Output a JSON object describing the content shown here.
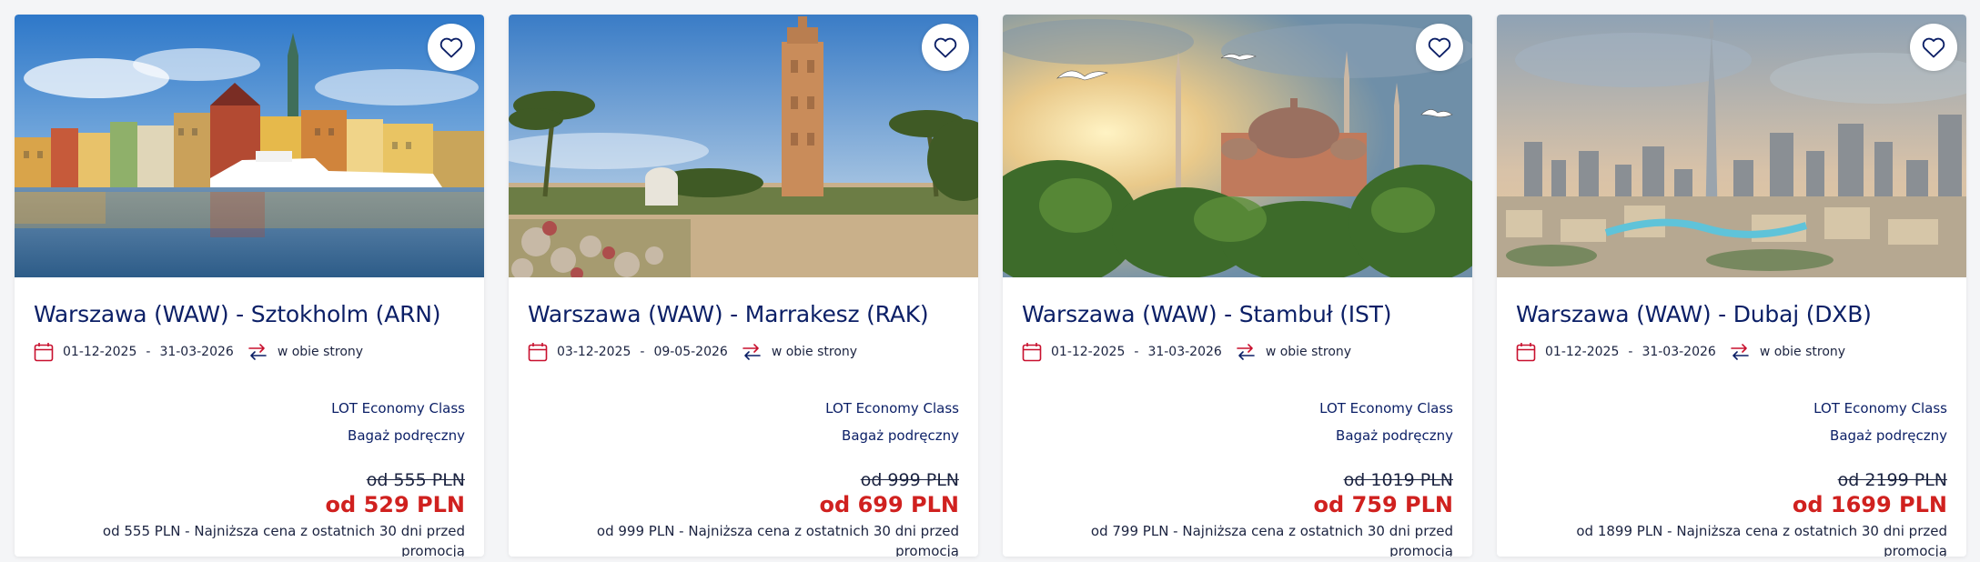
{
  "cards": [
    {
      "route": "Warszawa (WAW) - Sztokholm (ARN)",
      "date_from": "01-12-2025",
      "date_to": "31-03-2026",
      "trip_type": "w obie strony",
      "cabin_class": "LOT Economy Class",
      "baggage": "Bagaż podręczny",
      "old_price": "od 555 PLN",
      "new_price": "od 529 PLN",
      "price_note_line1": "od 555 PLN - Najniższa cena z ostatnich 30 dni przed",
      "price_note_line2": "promocją",
      "image": "stockholm-harbor"
    },
    {
      "route": "Warszawa (WAW) - Marrakesz (RAK)",
      "date_from": "03-12-2025",
      "date_to": "09-05-2026",
      "trip_type": "w obie strony",
      "cabin_class": "LOT Economy Class",
      "baggage": "Bagaż podręczny",
      "old_price": "od 999 PLN",
      "new_price": "od 699 PLN",
      "price_note_line1": "od 999 PLN - Najniższa cena z ostatnich 30 dni przed",
      "price_note_line2": "promocją",
      "image": "marrakesh-minaret"
    },
    {
      "route": "Warszawa (WAW) - Stambuł (IST)",
      "date_from": "01-12-2025",
      "date_to": "31-03-2026",
      "trip_type": "w obie strony",
      "cabin_class": "LOT Economy Class",
      "baggage": "Bagaż podręczny",
      "old_price": "od 1019 PLN",
      "new_price": "od 759 PLN",
      "price_note_line1": "od 799 PLN - Najniższa cena z ostatnich 30 dni przed",
      "price_note_line2": "promocją",
      "image": "istanbul-hagia-sophia"
    },
    {
      "route": "Warszawa (WAW) - Dubaj (DXB)",
      "date_from": "01-12-2025",
      "date_to": "31-03-2026",
      "trip_type": "w obie strony",
      "cabin_class": "LOT Economy Class",
      "baggage": "Bagaż podręczny",
      "old_price": "od 2199 PLN",
      "new_price": "od 1699 PLN",
      "price_note_line1": "od 1899 PLN - Najniższa cena z ostatnich 30 dni przed",
      "price_note_line2": "promocją",
      "image": "dubai-skyline"
    }
  ],
  "date_separator": "-",
  "colors": {
    "brand_navy": "#0b1f66",
    "price_red": "#d0211f",
    "icon_red": "#c8102e"
  },
  "icons": {
    "favorite": "heart-outline-icon",
    "dates": "calendar-icon",
    "trip": "round-trip-arrows-icon"
  }
}
